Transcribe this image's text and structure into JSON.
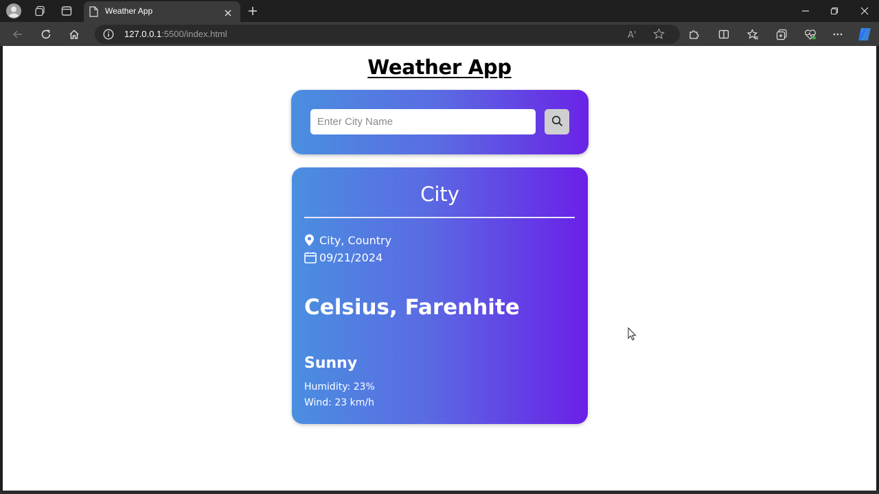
{
  "browser": {
    "tab_title": "Weather App",
    "url_host": "127.0.0.1",
    "url_rest": ":5500/index.html"
  },
  "page": {
    "title": "Weather App",
    "search": {
      "placeholder": "Enter City Name",
      "value": ""
    },
    "weather": {
      "city": "City",
      "location": "City, Country",
      "date": "09/21/2024",
      "temperature": "Celsius, Farenhite",
      "condition": "Sunny",
      "humidity": "Humidity: 23%",
      "wind": "Wind: 23 km/h"
    }
  },
  "icons": {
    "profile": "avatar-icon",
    "workspaces": "workspaces-icon",
    "tab_actions": "tab-actions-icon",
    "page": "page-icon",
    "close_tab": "close-icon",
    "new_tab": "plus-icon",
    "back": "back-arrow-icon",
    "refresh": "refresh-icon",
    "home": "home-icon",
    "site_info": "info-icon",
    "read_aloud": "read-aloud-icon",
    "favorite": "star-icon",
    "extensions": "puzzle-icon",
    "split_screen": "split-screen-icon",
    "favorites": "favorites-icon",
    "collections": "collections-icon",
    "performance": "heart-pulse-icon",
    "more": "more-icon",
    "copilot": "copilot-icon",
    "search": "search-icon",
    "location": "map-pin-icon",
    "calendar": "calendar-icon"
  },
  "colors": {
    "gradient_start": "#4a8fe0",
    "gradient_end": "#6a20e8",
    "search_button": "#cfcfcf"
  }
}
